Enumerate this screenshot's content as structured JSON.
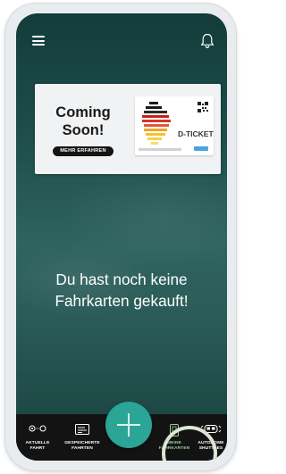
{
  "banner": {
    "title_line1": "Coming",
    "title_line2": "Soon!",
    "button_label": "MEHR ERFAHREN",
    "ticket_label": "D-TICKET"
  },
  "main": {
    "empty_line1": "Du hast noch keine",
    "empty_line2": "Fahrkarten gekauft!"
  },
  "nav": {
    "items": [
      {
        "line1": "AKTUELLE",
        "line2": "FAHRT",
        "icon": "current-ride-icon"
      },
      {
        "line1": "GESPEICHERTE",
        "line2": "FAHRTEN",
        "icon": "saved-rides-icon"
      },
      {
        "line1": "MEINE",
        "line2": "FAHRKARTEN",
        "icon": "ticket-phone-icon"
      },
      {
        "line1": "AUTONOME",
        "line2": "SHUTTLES",
        "icon": "shuttle-icon"
      }
    ],
    "active_index": 2
  },
  "fab": {
    "icon": "plus-icon"
  },
  "colors": {
    "accent": "#2aa596",
    "background_dark": "#133c3a",
    "navbar": "#131313",
    "highlight_ring": "#dde6d6",
    "active_label": "#9cc9a0"
  }
}
